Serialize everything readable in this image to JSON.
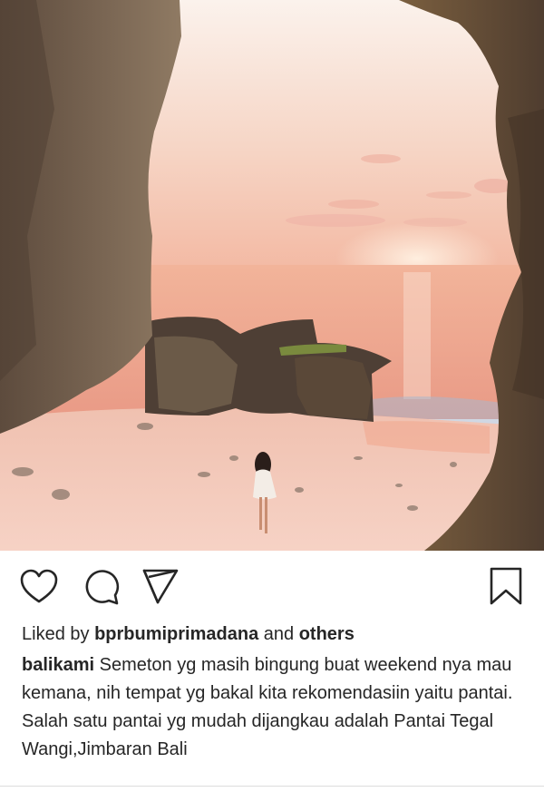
{
  "post": {
    "photo_icon": "beach-cave-photo",
    "liked": {
      "prefix": "Liked by",
      "user": "bprbumiprimadana",
      "and": "and",
      "others": "others"
    },
    "caption": {
      "username": "balikami",
      "first_line": "Semeton yg masih bingung buat weekend nya mau kemana, nih tempat yg bakal kita rekomendasiin yaitu pantai.",
      "second_line": "Salah satu pantai yg mudah dijangkau adalah Pantai Tegal Wangi,Jimbaran Bali"
    }
  },
  "icons": {
    "like": "heart-icon",
    "comment": "comment-icon",
    "share": "send-icon",
    "save": "bookmark-icon"
  },
  "colors": {
    "text": "#262626",
    "sky": "#f6c7b0",
    "sand": "#f4c7b8",
    "rock": "#6b5a4a"
  }
}
